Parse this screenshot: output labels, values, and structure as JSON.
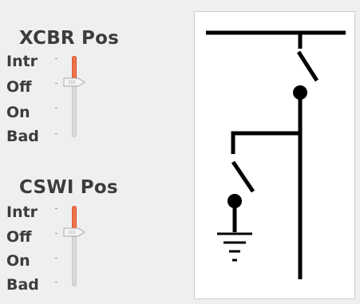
{
  "xcbr": {
    "title": "XCBR Pos",
    "labels": [
      "Intr",
      "Off",
      "On",
      "Bad"
    ],
    "value": "Off"
  },
  "cswi": {
    "title": "CSWI Pos",
    "labels": [
      "Intr",
      "Off",
      "On",
      "Bad"
    ],
    "value": "Off"
  },
  "colors": {
    "slider_fill": "#f0734a",
    "diagram_line": "#000000",
    "panel_bg": "#ffffff"
  },
  "diagram": {
    "switch_state": "open",
    "earth_switch_state": "open"
  }
}
